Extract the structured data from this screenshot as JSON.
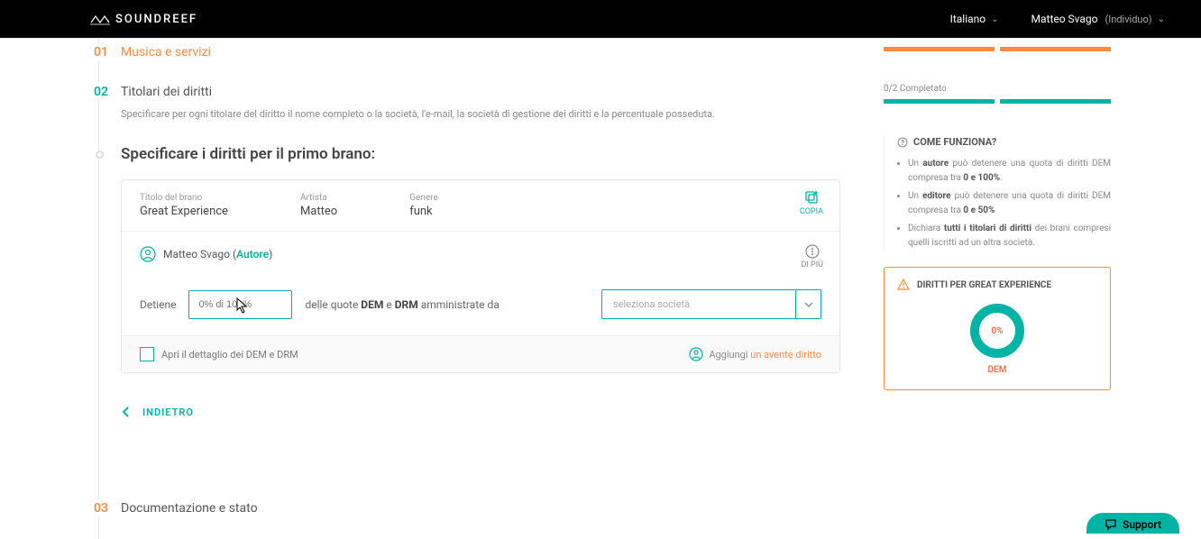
{
  "topbar": {
    "brand": "SOUNDREEF",
    "language": "Italiano",
    "user": "Matteo Svago",
    "account_type": "(Individuo)"
  },
  "steps": {
    "s1": {
      "num": "01",
      "title": "Musica e servizi"
    },
    "s2": {
      "num": "02",
      "title": "Titolari dei diritti",
      "desc": "Specificare per ogni titolare del diritto il nome completo o la società, l'e-mail, la società di gestione dei diritti e la percentuale posseduta."
    },
    "s3": {
      "num": "03",
      "title": "Documentazione e stato"
    }
  },
  "section": {
    "title": "Specificare i diritti per il primo brano:"
  },
  "card": {
    "title_label": "Titolo del brano",
    "title_value": "Great Experience",
    "artist_label": "Artista",
    "artist_value": "Matteo",
    "genre_label": "Genere",
    "genre_value": "funk",
    "copy": "COPIA",
    "more": "DI PIÙ",
    "person_name": "Matteo Svago",
    "person_role": "Autore",
    "holds": "Detiene",
    "placeholder_pct": "0% di 100%",
    "mid_pre": "delle quote",
    "mid_dem": "DEM",
    "mid_e": "e",
    "mid_drm": "DRM",
    "mid_post": "amministrate da",
    "society_placeholder": "seleziona società",
    "footer_left": "Apri il dettaglio dei DEM e DRM",
    "add_prefix": "Aggiungi",
    "add_link": "un avente diritto"
  },
  "back": "INDIETRO",
  "right": {
    "completed": "0/2 Completato",
    "help_title": "COME FUNZIONA?",
    "bullets": [
      {
        "pre": "Un ",
        "b1": "autore",
        "mid": " può detenere una quota di diritti DEM compresa tra ",
        "b2": "0 e 100%",
        "post": "."
      },
      {
        "pre": "Un ",
        "b1": "editore",
        "mid": " può detenere una quota di diritti DEM compresa tra ",
        "b2": "0 e 50%",
        "post": ""
      },
      {
        "pre": "Dichiara ",
        "b1": "tutti i titolari di diritti",
        "mid": " dei brani compresi quelli iscritti ad un altra società.",
        "b2": "",
        "post": ""
      }
    ],
    "warn_title": "DIRITTI PER GREAT EXPERIENCE",
    "donut_pct": "0%",
    "donut_label": "DEM"
  },
  "support": "Support",
  "colors": {
    "teal": "#00b4a5",
    "orange": "#ff8a3d"
  }
}
